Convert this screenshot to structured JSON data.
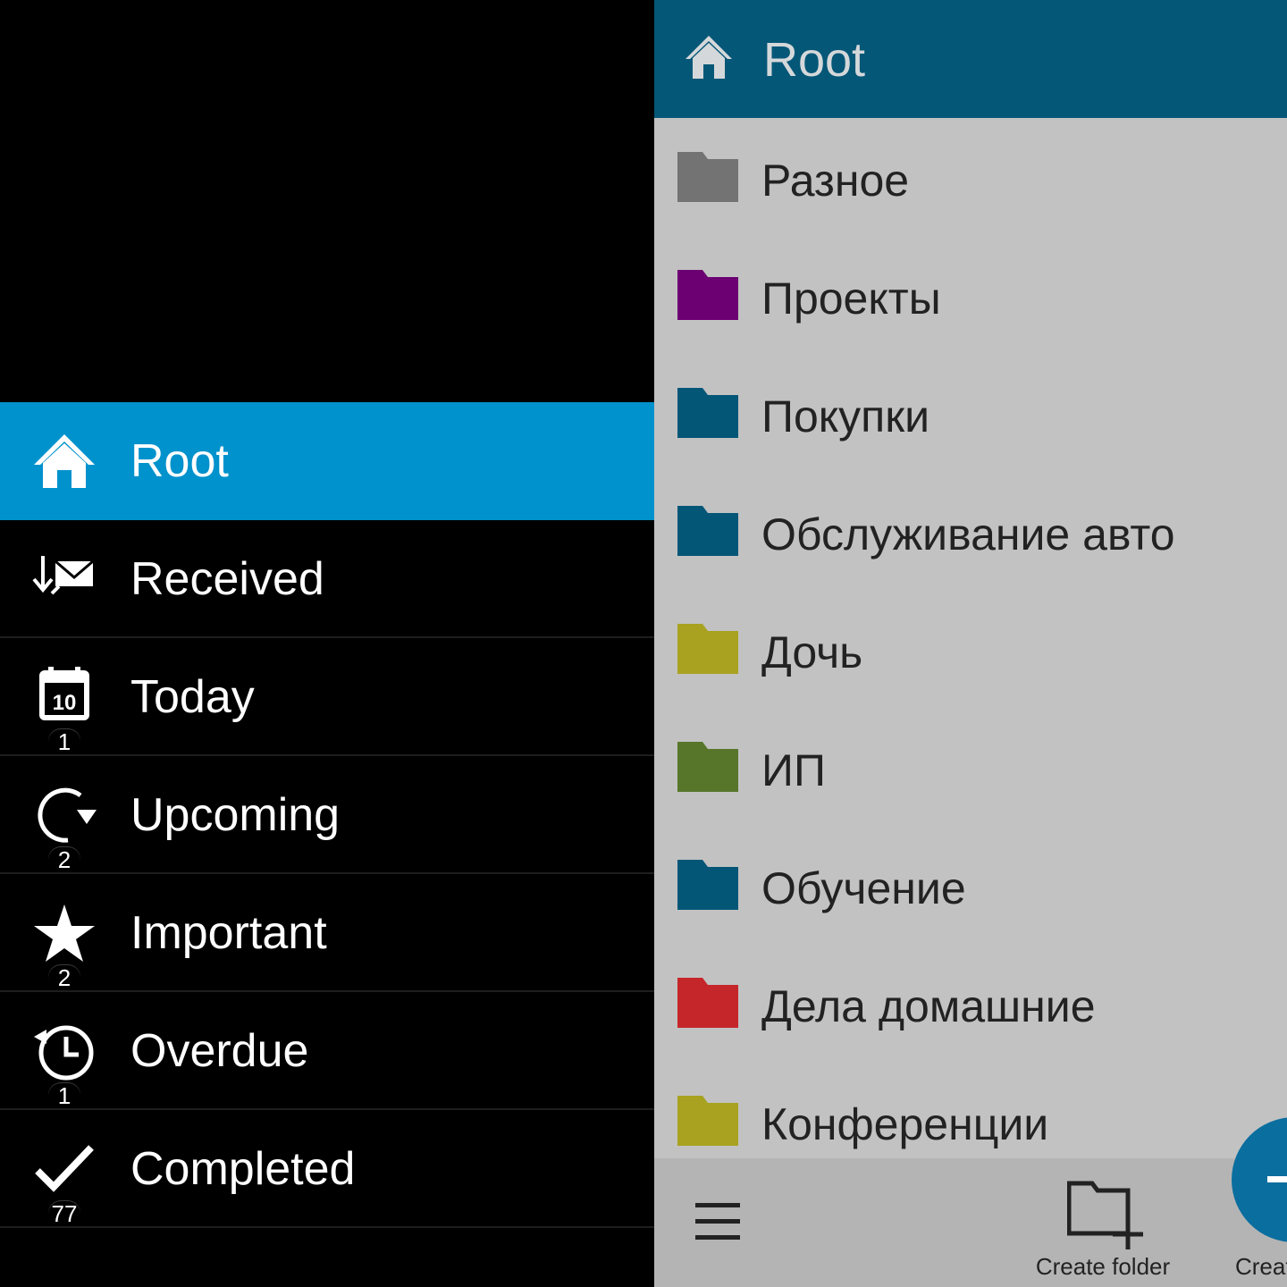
{
  "sidebar": {
    "items": [
      {
        "label": "Root",
        "icon": "home-icon",
        "active": true
      },
      {
        "label": "Received",
        "icon": "received-mail-icon"
      },
      {
        "label": "Today",
        "icon": "calendar-icon",
        "icon_text": "10",
        "badge": "1"
      },
      {
        "label": "Upcoming",
        "icon": "refresh-arrow-icon",
        "badge": "2"
      },
      {
        "label": "Important",
        "icon": "star-icon",
        "badge": "2"
      },
      {
        "label": "Overdue",
        "icon": "clock-history-icon",
        "badge": "1"
      },
      {
        "label": "Completed",
        "icon": "checkmark-icon",
        "badge": "77"
      }
    ]
  },
  "header": {
    "title": "Root",
    "icon": "home-icon"
  },
  "folders": [
    {
      "label": "Разное",
      "color": "#737373"
    },
    {
      "label": "Проекты",
      "color": "#6c0072"
    },
    {
      "label": "Покупки",
      "color": "#045677"
    },
    {
      "label": "Обслуживание авто",
      "color": "#045677"
    },
    {
      "label": "Дочь",
      "color": "#a8a220"
    },
    {
      "label": "ИП",
      "color": "#57762a"
    },
    {
      "label": "Обучение",
      "color": "#045677"
    },
    {
      "label": "Дела домашние",
      "color": "#c5262a"
    },
    {
      "label": "Конференции",
      "color": "#a8a220"
    }
  ],
  "action_bar": {
    "menu_icon": "hamburger-menu-icon",
    "create_folder_label": "Create folder",
    "create_label_partial": "Creat"
  },
  "colors": {
    "accent": "#0092cc",
    "header": "#055777",
    "fab": "#0a6e9f"
  }
}
